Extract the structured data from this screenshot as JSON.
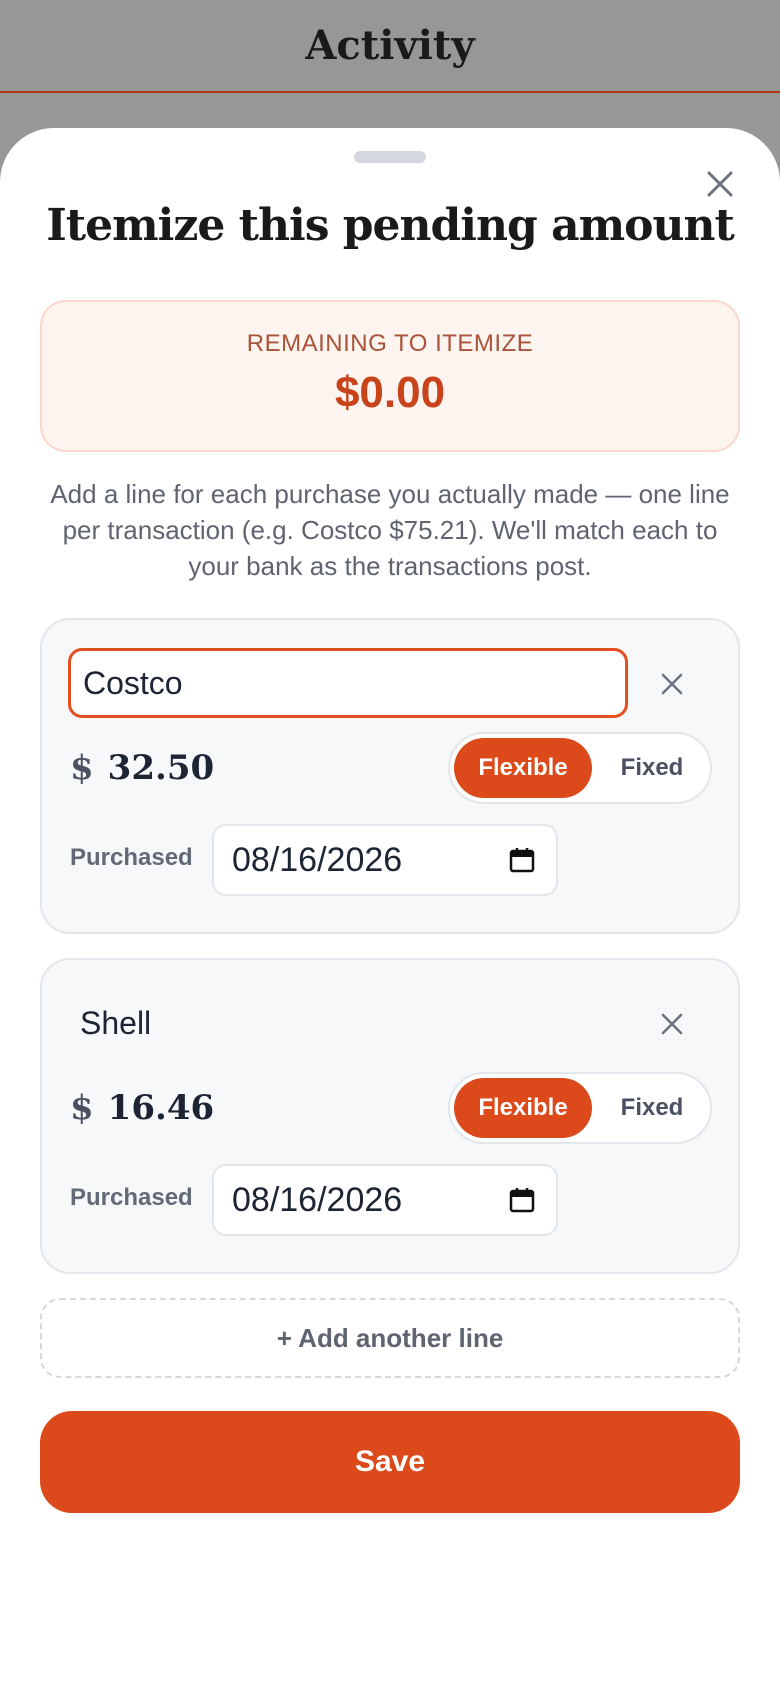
{
  "header": {
    "title": "Activity"
  },
  "sheet": {
    "title": "Itemize this pending amount",
    "close_icon": "close-icon",
    "remaining": {
      "label": "REMAINING TO ITEMIZE",
      "value": "$0.00"
    },
    "help_text": "Add a line for each purchase you actually made — one line per transaction (e.g. Costco $75.21). We'll match each to your bank as the transactions post.",
    "lines": [
      {
        "name": "Costco",
        "currency": "$",
        "amount": "32.50",
        "toggle_options": [
          "Flexible",
          "Fixed"
        ],
        "selected": "Flexible",
        "purchased_label": "Purchased",
        "date": "08/16/2026"
      },
      {
        "name": "Shell",
        "currency": "$",
        "amount": "16.46",
        "toggle_options": [
          "Flexible",
          "Fixed"
        ],
        "selected": "Flexible",
        "purchased_label": "Purchased",
        "date": "08/16/2026"
      }
    ],
    "add_line_label": "+ Add another line",
    "save_label": "Save"
  },
  "colors": {
    "accent": "#dc4a1c",
    "remaining_bg": "#fdf3ef",
    "remaining_text": "#c9431a",
    "overlay": "#979797"
  }
}
